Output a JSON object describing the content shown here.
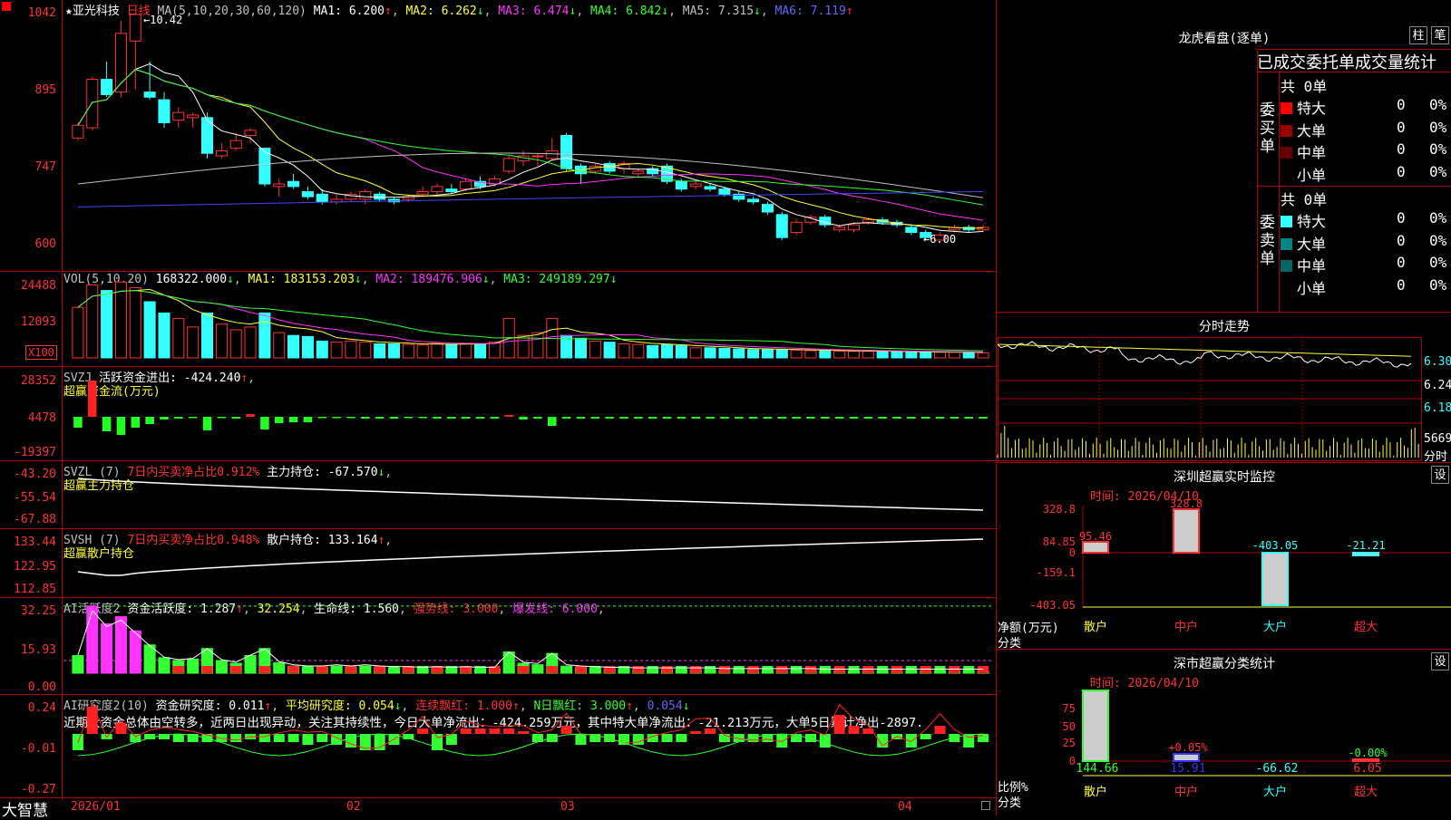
{
  "stock": {
    "name": "★亚光科技",
    "period": "日线"
  },
  "k": {
    "legend": {
      "ma": "MA(5,10,20,30,60,120)",
      "ma1": "MA1: 6.200",
      "ma2": "MA2: 6.262",
      "ma3": "MA3: 6.474",
      "ma4": "MA4: 6.842",
      "ma5": "MA5: 7.315",
      "ma6": "MA6: 7.119"
    },
    "arrows": {
      "ma1": "↑",
      "ma2": "↓",
      "ma3": "↓",
      "ma4": "↓",
      "ma5": "↓",
      "ma6": "↑"
    },
    "yticks": [
      "1042",
      "895",
      "747",
      "600"
    ],
    "max_label": "10.42",
    "min_label": "6.00",
    "candles": [
      [
        8.0,
        8.25,
        7.95,
        8.3
      ],
      [
        8.2,
        9.15,
        8.15,
        9.2
      ],
      [
        9.15,
        8.85,
        8.8,
        9.5
      ],
      [
        8.9,
        10.05,
        8.8,
        10.3
      ],
      [
        9.9,
        10.42,
        8.95,
        10.42
      ],
      [
        8.9,
        8.8,
        8.75,
        9.5
      ],
      [
        8.75,
        8.3,
        8.2,
        8.9
      ],
      [
        8.35,
        8.5,
        8.2,
        8.6
      ],
      [
        8.4,
        8.45,
        8.2,
        8.5
      ],
      [
        8.4,
        7.7,
        7.6,
        8.5
      ],
      [
        7.65,
        7.75,
        7.6,
        7.9
      ],
      [
        7.8,
        7.95,
        7.75,
        8.1
      ],
      [
        8.05,
        8.15,
        7.9,
        8.2
      ],
      [
        7.8,
        7.1,
        7.05,
        7.8
      ],
      [
        7.05,
        7.1,
        6.85,
        7.2
      ],
      [
        7.15,
        7.05,
        7.0,
        7.3
      ],
      [
        6.95,
        6.85,
        6.8,
        7.05
      ],
      [
        6.9,
        6.75,
        6.7,
        7.0
      ],
      [
        6.75,
        6.8,
        6.7,
        6.9
      ],
      [
        6.8,
        6.9,
        6.75,
        6.95
      ],
      [
        6.8,
        6.95,
        6.7,
        7.0
      ],
      [
        6.9,
        6.8,
        6.75,
        6.95
      ],
      [
        6.8,
        6.75,
        6.7,
        6.85
      ],
      [
        6.8,
        6.85,
        6.75,
        6.9
      ],
      [
        6.9,
        6.95,
        6.85,
        7.05
      ],
      [
        6.95,
        7.05,
        6.85,
        7.1
      ],
      [
        7.0,
        6.95,
        6.9,
        7.1
      ],
      [
        7.0,
        7.15,
        6.95,
        7.2
      ],
      [
        7.15,
        7.05,
        7.0,
        7.25
      ],
      [
        7.1,
        7.2,
        7.05,
        7.25
      ],
      [
        7.35,
        7.6,
        7.3,
        7.65
      ],
      [
        7.55,
        7.65,
        7.45,
        7.75
      ],
      [
        7.65,
        7.65,
        7.45,
        7.7
      ],
      [
        7.6,
        7.75,
        7.55,
        8.0
      ],
      [
        8.05,
        7.4,
        7.35,
        8.1
      ],
      [
        7.45,
        7.3,
        7.1,
        7.5
      ],
      [
        7.35,
        7.45,
        7.3,
        7.5
      ],
      [
        7.5,
        7.35,
        7.3,
        7.55
      ],
      [
        7.4,
        7.5,
        7.3,
        7.55
      ],
      [
        7.3,
        7.35,
        7.25,
        7.4
      ],
      [
        7.4,
        7.3,
        7.25,
        7.45
      ],
      [
        7.45,
        7.15,
        7.1,
        7.5
      ],
      [
        7.15,
        7.0,
        6.95,
        7.2
      ],
      [
        7.05,
        7.1,
        7.0,
        7.15
      ],
      [
        7.05,
        7.0,
        6.95,
        7.1
      ],
      [
        7.0,
        6.9,
        6.85,
        7.05
      ],
      [
        6.9,
        6.8,
        6.75,
        6.95
      ],
      [
        6.8,
        6.75,
        6.7,
        6.85
      ],
      [
        6.7,
        6.55,
        6.5,
        6.75
      ],
      [
        6.5,
        6.05,
        6.0,
        6.55
      ],
      [
        6.15,
        6.35,
        6.1,
        6.4
      ],
      [
        6.35,
        6.45,
        6.3,
        6.5
      ],
      [
        6.45,
        6.3,
        6.25,
        6.5
      ],
      [
        6.2,
        6.25,
        6.15,
        6.3
      ],
      [
        6.2,
        6.3,
        6.15,
        6.35
      ],
      [
        6.35,
        6.4,
        6.3,
        6.45
      ],
      [
        6.4,
        6.35,
        6.3,
        6.45
      ],
      [
        6.35,
        6.3,
        6.25,
        6.4
      ],
      [
        6.25,
        6.15,
        6.1,
        6.3
      ],
      [
        6.15,
        6.05,
        6.0,
        6.2
      ],
      [
        6.0,
        6.1,
        6.0,
        6.15
      ],
      [
        6.2,
        6.25,
        6.15,
        6.3
      ],
      [
        6.25,
        6.2,
        6.15,
        6.3
      ],
      [
        6.2,
        6.25,
        6.15,
        6.3
      ]
    ]
  },
  "vol": {
    "legend": {
      "name": "VOL(5,10,20)",
      "val": "168322.000",
      "ma1": "MA1: 183153.203",
      "ma2": "MA2: 189476.906",
      "ma3": "MA3: 249189.297"
    },
    "arrows": {
      "val": "↓",
      "ma1": "↓",
      "ma2": "↓",
      "ma3": "↓"
    },
    "yticks": [
      "24488",
      "12093"
    ],
    "unit": "X100"
  },
  "svzj": {
    "legend": {
      "name": "SVZJ",
      "text": "活跃资金进出: -424.240",
      "arrow": "↑",
      "sub": "超赢资金流(万元)"
    },
    "yticks": [
      "28352",
      "4478",
      "-19397"
    ]
  },
  "svzl": {
    "legend": {
      "name": "SVZL (7)",
      "a": "7日内买卖净占比0.912%",
      "b": "主力持仓: -67.570",
      "arrow": "↓",
      "sub": "超赢主力持仓"
    },
    "yticks": [
      "-43.20",
      "-55.54",
      "-67.88"
    ]
  },
  "svsh": {
    "legend": {
      "name": "SVSH (7)",
      "a": "7日内买卖净占比0.948%",
      "b": "散户持仓: 133.164",
      "arrow": "↑",
      "sub": "超赢散户持仓"
    },
    "yticks": [
      "133.44",
      "122.95",
      "112.85"
    ]
  },
  "ai1": {
    "legend": {
      "name": "AI活跃度2",
      "a": "资金活跃度: 1.287",
      "a_arrow": "↑",
      "b": "32.254",
      "c": "生命线: 1.560",
      "d": "强势线: 3.000",
      "e": "爆发线: 6.000"
    },
    "yticks": [
      "32.25",
      "15.93",
      "0.00"
    ]
  },
  "ai2": {
    "legend": {
      "name": "AI研究度2(10)",
      "a": "资金研究度: 0.011",
      "a_arrow": "↑",
      "b": "平均研究度: 0.054",
      "b_arrow": "↓",
      "c": "连续飘红: 1.000",
      "c_arrow": "↑",
      "d": "N日飘红: 3.000",
      "d_arrow": "↑",
      "e": "0.054",
      "e_arrow": "↓"
    },
    "comment": "近期大资金总体由空转多，近两日出现异动，关注其持续性，今日大单净流出：-424.259万元，其中特大单净流出：-21.213万元，大单5日累计净出-2897.",
    "yticks": [
      "0.24",
      "-0.01",
      "-0.27"
    ]
  },
  "xaxis": {
    "brand": "大智慧",
    "labels": [
      "2026/01",
      "02",
      "03",
      "04"
    ]
  },
  "right": {
    "title": "龙虎看盘(逐单)",
    "btn_col": "柱",
    "btn_bar": "笔",
    "tabs": "已成交委托单成交量统计",
    "buy": {
      "label": "委买单",
      "total": "共 0单",
      "rows": [
        {
          "name": "特大",
          "v": "0",
          "p": "0%",
          "c": "#ff0000"
        },
        {
          "name": "大单",
          "v": "0",
          "p": "0%",
          "c": "#990000"
        },
        {
          "name": "中单",
          "v": "0",
          "p": "0%",
          "c": "#660000"
        },
        {
          "name": "小单",
          "v": "0",
          "p": "0%",
          "c": "#000000"
        }
      ]
    },
    "sell": {
      "label": "委卖单",
      "total": "共 0单",
      "rows": [
        {
          "name": "特大",
          "v": "0",
          "p": "0%",
          "c": "#33ffff"
        },
        {
          "name": "大单",
          "v": "0",
          "p": "0%",
          "c": "#008888"
        },
        {
          "name": "中单",
          "v": "0",
          "p": "0%",
          "c": "#006666"
        },
        {
          "name": "小单",
          "v": "0",
          "p": "0%",
          "c": "#000000"
        }
      ]
    },
    "intraday": {
      "title": "分时走势",
      "yticks": [
        "6.30",
        "6.24",
        "6.18"
      ],
      "vol": "5669",
      "vol_unit": "分时"
    },
    "sz_monitor": {
      "title": "深圳超赢实时监控",
      "btn": "设",
      "date": "时间: 2026/04/10",
      "yticks": [
        "328.8",
        "84.85",
        "0",
        "-159.1",
        "-403.05"
      ],
      "ylab1": "净额(万元)",
      "ylab2": "分类",
      "cats": [
        "散户",
        "中户",
        "大户",
        "超大"
      ],
      "values": [
        "95.46",
        "328.8",
        "-403.05",
        "-21.21"
      ]
    },
    "sz_class": {
      "title": "深市超赢分类统计",
      "btn": "设",
      "date": "时间: 2026/04/10",
      "yticks": [
        "75",
        "50",
        "25",
        "0"
      ],
      "ylab1": "比例%",
      "ylab2": "分类",
      "cats": [
        "散户",
        "中户",
        "大户",
        "超大"
      ],
      "pct": [
        "",
        "+0.05%",
        "",
        "-0.00%"
      ],
      "values": [
        "144.66",
        "15.91",
        "-66.62",
        "6.05"
      ]
    }
  }
}
